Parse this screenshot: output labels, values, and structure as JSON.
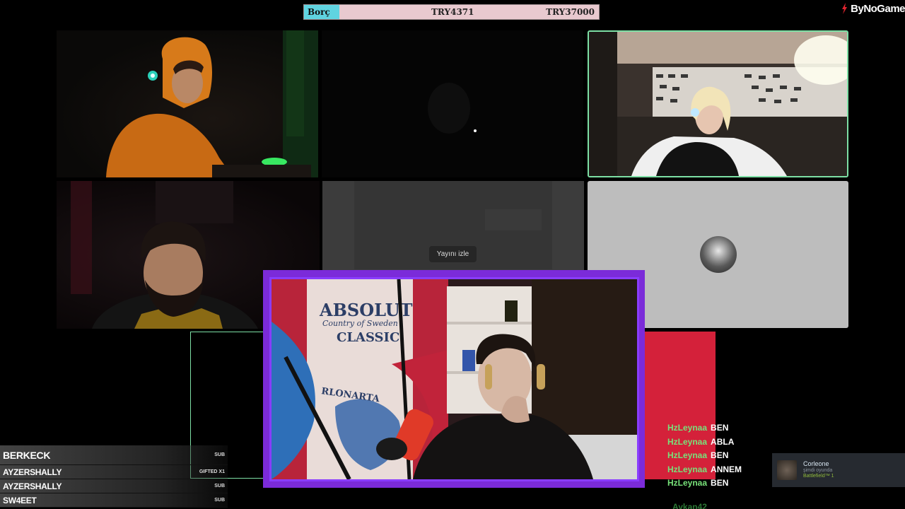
{
  "debt_bar": {
    "label": "Borç",
    "current": "TRY4371",
    "target": "TRY37000"
  },
  "brand": {
    "name": "ByNoGame"
  },
  "stream_tile": {
    "watch_label": "Yayını izle"
  },
  "chat": {
    "messages": [
      {
        "user": "HzLeynaa",
        "text": "BEN"
      },
      {
        "user": "HzLeynaa",
        "text": "ABLA"
      },
      {
        "user": "HzLeynaa",
        "text": "BEN"
      },
      {
        "user": "HzLeynaa",
        "text": "ANNEM"
      },
      {
        "user": "HzLeynaa",
        "text": "BEN"
      }
    ],
    "faded_user": "Aykan42"
  },
  "subs": [
    {
      "name": "BERKECK",
      "type": "SUB"
    },
    {
      "name": "AYZERSHALLY",
      "type": "GIFTED X1"
    },
    {
      "name": "AYZERSHALLY",
      "type": "SUB"
    },
    {
      "name": "SW4EET",
      "type": "SUB"
    }
  ],
  "steam_notification": {
    "name": "Corleone",
    "status": "şimdi oyunda",
    "game": "Battlefield™ 1"
  },
  "colors": {
    "accent_purple": "#8a3cff",
    "tile_border_green": "#7de0a5",
    "chat_username": "#78e27a",
    "debt_label_bg": "#5fd3e0",
    "red_panel": "#d4213a"
  },
  "main_cam_poster": {
    "line1": "ABSOLUT",
    "line2": "Country of Sweden",
    "line3": "CLASSIC",
    "line4": "RLONARTA"
  }
}
